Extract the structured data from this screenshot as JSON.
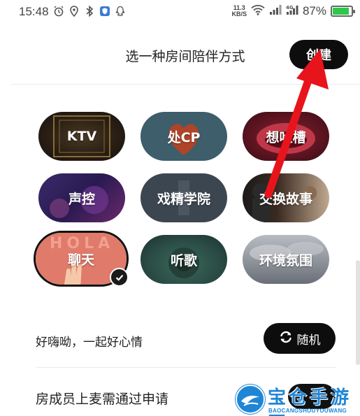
{
  "status_bar": {
    "time": "15:48",
    "net_speed_value": "11.3",
    "net_speed_unit": "KB/S",
    "battery": "87%",
    "battery_level": 0.87
  },
  "header": {
    "title": "选一种房间陪伴方式",
    "create_label": "创建"
  },
  "modes": [
    {
      "label": "KTV",
      "selected": false
    },
    {
      "label": "处CP",
      "selected": false
    },
    {
      "label": "想吐槽",
      "selected": false
    },
    {
      "label": "声控",
      "selected": false
    },
    {
      "label": "戏精学院",
      "selected": false
    },
    {
      "label": "交换故事",
      "selected": false
    },
    {
      "label": "聊天",
      "selected": true
    },
    {
      "label": "听歌",
      "selected": false
    },
    {
      "label": "环境氛围",
      "selected": false
    }
  ],
  "greeting": {
    "text": "好嗨呦，一起好心情",
    "random_label": "随机"
  },
  "mic_setting": {
    "label": "房成员上麦需通过申请",
    "enabled": true
  },
  "watermark": {
    "title": "宝仓手游网",
    "subtitle": "BAOCANGSHOUYOUWANG"
  },
  "colors": {
    "accent": "#0d0d0d",
    "arrow": "#e8141c",
    "battery": "#2ec84a",
    "watermark": "#1f86d6"
  }
}
